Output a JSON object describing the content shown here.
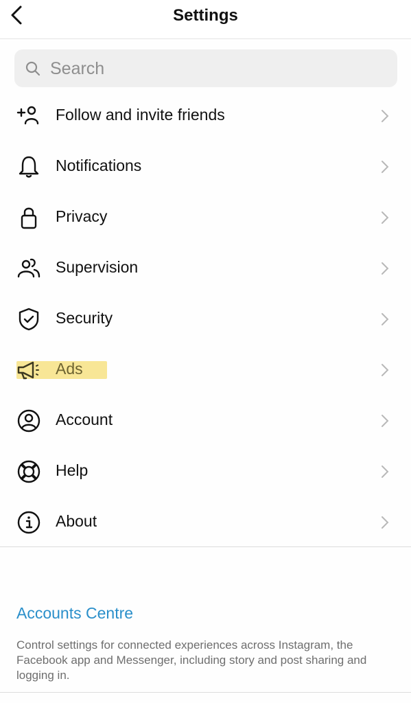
{
  "header": {
    "title": "Settings",
    "back_icon": "chevron-left-icon"
  },
  "search": {
    "placeholder": "Search",
    "value": "",
    "icon": "search-icon"
  },
  "menu": {
    "items": [
      {
        "label": "Follow and invite friends",
        "icon": "add-person-icon",
        "highlighted": false
      },
      {
        "label": "Notifications",
        "icon": "bell-icon",
        "highlighted": false
      },
      {
        "label": "Privacy",
        "icon": "lock-icon",
        "highlighted": false
      },
      {
        "label": "Supervision",
        "icon": "people-icon",
        "highlighted": false
      },
      {
        "label": "Security",
        "icon": "shield-check-icon",
        "highlighted": false
      },
      {
        "label": "Ads",
        "icon": "megaphone-icon",
        "highlighted": true
      },
      {
        "label": "Account",
        "icon": "account-circle-icon",
        "highlighted": false
      },
      {
        "label": "Help",
        "icon": "lifebuoy-icon",
        "highlighted": false
      },
      {
        "label": "About",
        "icon": "info-icon",
        "highlighted": false
      }
    ],
    "chevron_icon": "chevron-right-icon"
  },
  "accounts_centre": {
    "link_label": "Accounts Centre",
    "description": "Control settings for connected experiences across Instagram, the Facebook app and Messenger, including story and post sharing and logging in."
  },
  "colors": {
    "link": "#2a8fca",
    "highlight": "#f8e696",
    "search_bg": "#efefef"
  }
}
